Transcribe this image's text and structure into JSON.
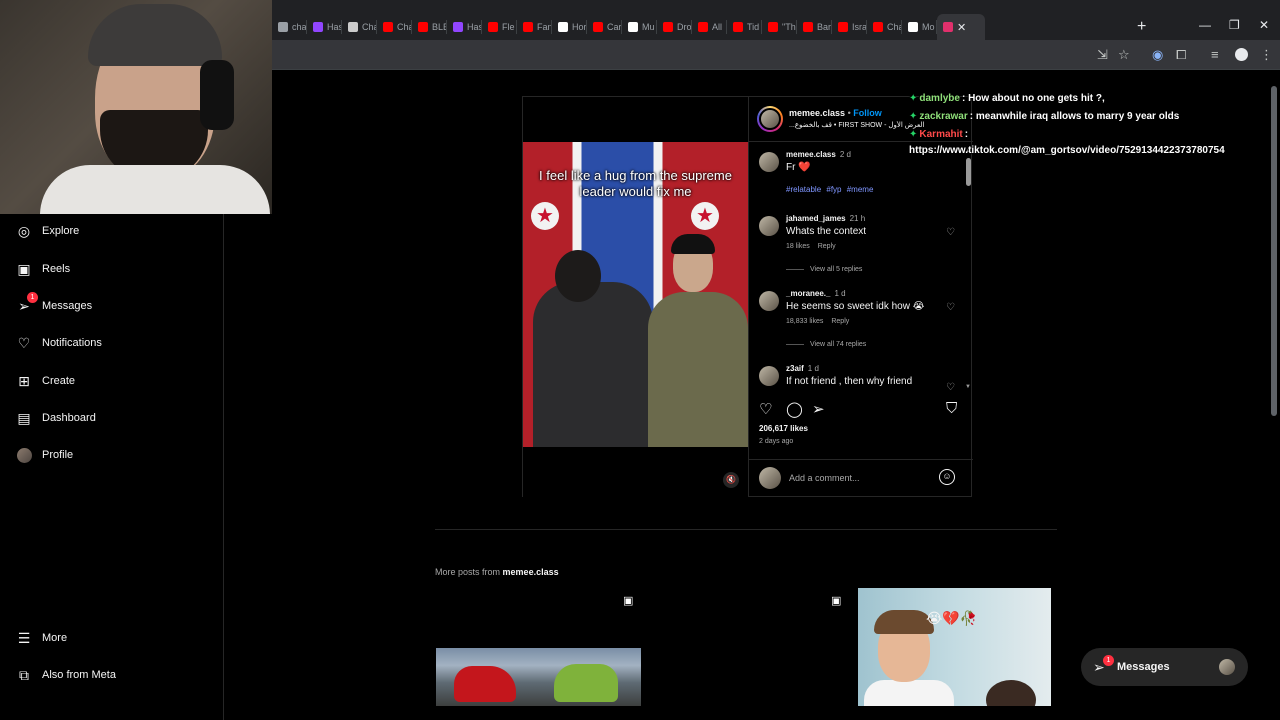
{
  "browser": {
    "tabs": [
      {
        "label": "cha",
        "color": "#9aa0a6"
      },
      {
        "label": "Has",
        "color": "#9146ff"
      },
      {
        "label": "Cha",
        "color": "#cccccc"
      },
      {
        "label": "Cha",
        "color": "#ff0000"
      },
      {
        "label": "BLE",
        "color": "#ff0000"
      },
      {
        "label": "Has",
        "color": "#9146ff"
      },
      {
        "label": "Fle",
        "color": "#ff0000"
      },
      {
        "label": "Fan",
        "color": "#ff0000"
      },
      {
        "label": "Hor",
        "color": "#ffffff"
      },
      {
        "label": "Car",
        "color": "#ff0000"
      },
      {
        "label": "Mu",
        "color": "#ffffff"
      },
      {
        "label": "Dro",
        "color": "#ff0000"
      },
      {
        "label": "All",
        "color": "#ff0000"
      },
      {
        "label": "Tid",
        "color": "#ff0000"
      },
      {
        "label": "\"Th",
        "color": "#ff0000"
      },
      {
        "label": "Bar",
        "color": "#ff0000"
      },
      {
        "label": "Isra",
        "color": "#ff0000"
      },
      {
        "label": "Cha",
        "color": "#ff0000"
      },
      {
        "label": "Mo",
        "color": "#ffffff"
      }
    ],
    "active_tab_color": "#e1306c",
    "close_glyph": "✕",
    "new_tab_glyph": "+",
    "win_minimize": "—",
    "win_restore": "❐",
    "win_close": "✕"
  },
  "sidebar": {
    "items": [
      {
        "label": "Explore",
        "icon": "compass-icon",
        "glyph": "◎"
      },
      {
        "label": "Reels",
        "icon": "reels-icon",
        "glyph": "▣"
      },
      {
        "label": "Messages",
        "icon": "messenger-icon",
        "glyph": "➢",
        "badge": "1"
      },
      {
        "label": "Notifications",
        "icon": "heart-icon",
        "glyph": "♡"
      },
      {
        "label": "Create",
        "icon": "plus-square-icon",
        "glyph": "⊞"
      },
      {
        "label": "Dashboard",
        "icon": "dashboard-icon",
        "glyph": "▤"
      },
      {
        "label": "Profile",
        "icon": "avatar"
      }
    ],
    "bottom": [
      {
        "label": "More",
        "icon": "menu-icon",
        "glyph": "☰"
      },
      {
        "label": "Also from Meta",
        "icon": "meta-icon",
        "glyph": "⧉"
      }
    ]
  },
  "post": {
    "username": "memee.class",
    "separator": "•",
    "follow_label": "Follow",
    "audio": "...قف بالخضوع • FIRST SHOW - العرض الأول",
    "video_caption": "I feel like a hug from the supreme leader would fix me",
    "mute_glyph": "🔇",
    "caption": {
      "username": "memee.class",
      "time": "2 d",
      "text": "Fr ❤️",
      "hashtags": [
        "#relatable",
        "#fyp",
        "#meme"
      ]
    },
    "comments": [
      {
        "username": "jahamed_james",
        "time": "21 h",
        "text": "Whats the context",
        "likes": "18 likes",
        "reply": "Reply",
        "view_replies": "View all 5 replies"
      },
      {
        "username": "_moranee._",
        "time": "1 d",
        "text": "He seems so sweet idk how 😭",
        "likes": "18,833 likes",
        "reply": "Reply",
        "view_replies": "View all 74 replies"
      },
      {
        "username": "z3aif",
        "time": "1 d",
        "text": "If not friend , then why friend"
      }
    ],
    "likes": "206,617 likes",
    "posted": "2 days ago",
    "comment_placeholder": "Add a comment...",
    "heart_glyph": "♡",
    "comment_glyph": "◯",
    "share_glyph": "➢",
    "save_glyph": "⛉",
    "emoji_glyph": "☺",
    "scroll_up": "▲",
    "scroll_down": "▼"
  },
  "chat": [
    {
      "badge": "✦",
      "name": "damlybe",
      "name_color": "#8fe07a",
      "text": ": How about no one gets hit ?,"
    },
    {
      "badge": "✦",
      "name": "zackrawar",
      "name_color": "#8fe07a",
      "text": ": meanwhile iraq allows to marry 9 year olds"
    },
    {
      "badge": "✦",
      "name": "Karmahit",
      "name_color": "#ff4a4a",
      "text": ":"
    },
    {
      "badge": "",
      "name": "",
      "name_color": "#ffffff",
      "text": "https://www.tiktok.com/@am_gortsov/video/7529134422373780754"
    }
  ],
  "more_posts": {
    "prefix": "More posts from",
    "username": "memee.class",
    "reel_glyph": "▣",
    "cartoon_emoji": "😭💔🥀"
  },
  "messages_pill": {
    "label": "Messages",
    "badge": "1",
    "glyph": "➢"
  }
}
